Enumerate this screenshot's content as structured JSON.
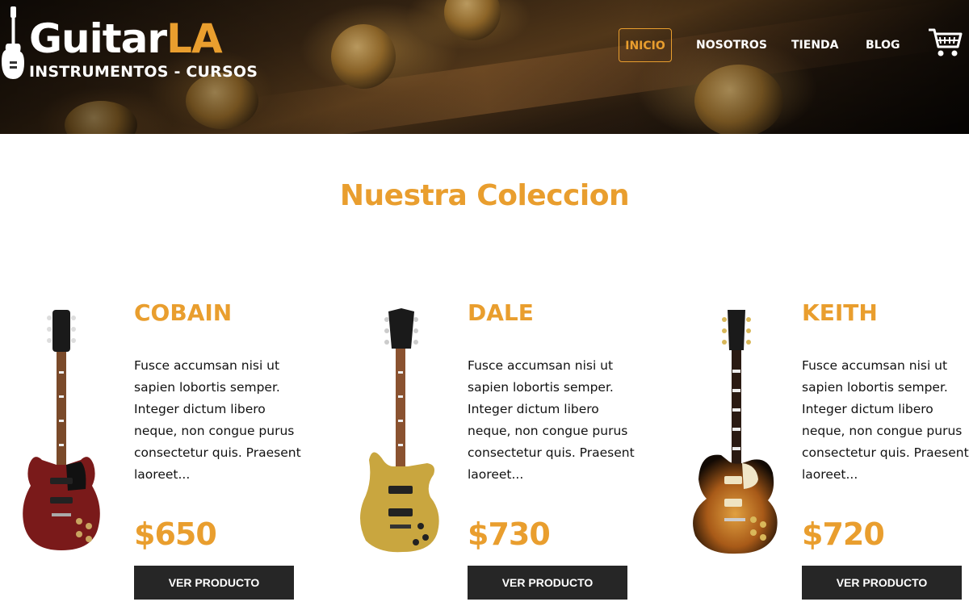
{
  "header": {
    "logo": {
      "title_white": "Guitar",
      "title_orange": "LA",
      "subtitle": "INSTRUMENTOS - CURSOS"
    },
    "nav": [
      {
        "label": "INICIO",
        "active": true
      },
      {
        "label": "NOSOTROS",
        "active": false
      },
      {
        "label": "TIENDA",
        "active": false
      },
      {
        "label": "BLOG",
        "active": false
      }
    ],
    "cart_icon": "shopping-cart-icon"
  },
  "main": {
    "title": "Nuestra Coleccion",
    "products": [
      {
        "name": "COBAIN",
        "description": "Fusce accumsan nisi ut sapien lobortis semper. Integer dictum libero neque, non congue purus consectetur quis. Praesent laoreet...",
        "price": "$650",
        "button": "VER PRODUCTO",
        "image": "red-sg-guitar"
      },
      {
        "name": "DALE",
        "description": "Fusce accumsan nisi ut sapien lobortis semper. Integer dictum libero neque, non congue purus consectetur quis. Praesent laoreet...",
        "price": "$730",
        "button": "VER PRODUCTO",
        "image": "gold-guitar"
      },
      {
        "name": "KEITH",
        "description": "Fusce accumsan nisi ut sapien lobortis semper. Integer dictum libero neque, non congue purus consectetur quis. Praesent laoreet...",
        "price": "$720",
        "button": "VER PRODUCTO",
        "image": "sunburst-les-paul-guitar"
      }
    ]
  },
  "colors": {
    "accent": "#e99e2e",
    "button_bg": "#262626",
    "text": "#111111"
  }
}
